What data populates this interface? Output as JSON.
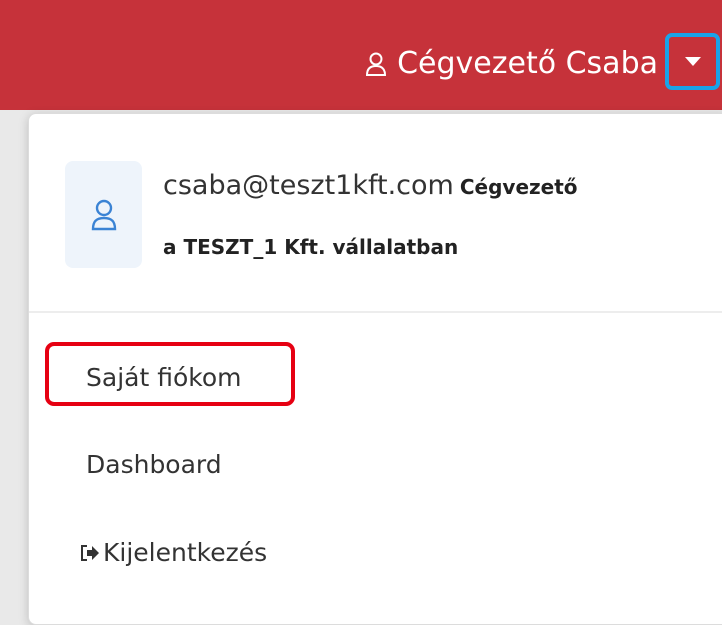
{
  "header": {
    "user_name": "Cégvezető Csaba"
  },
  "dropdown": {
    "email": "csaba@teszt1kft.com",
    "role": "Cégvezető",
    "company": "a TESZT_1 Kft. vállalatban",
    "items": [
      {
        "label": "Saját fiókom"
      },
      {
        "label": "Dashboard"
      },
      {
        "label": "Kijelentkezés",
        "icon": "sign-out-icon"
      }
    ]
  },
  "colors": {
    "header_bg": "#c6323a",
    "caret_highlight": "#1aa3e8",
    "item_highlight": "#e60012",
    "avatar_bg": "#eef4fb"
  }
}
